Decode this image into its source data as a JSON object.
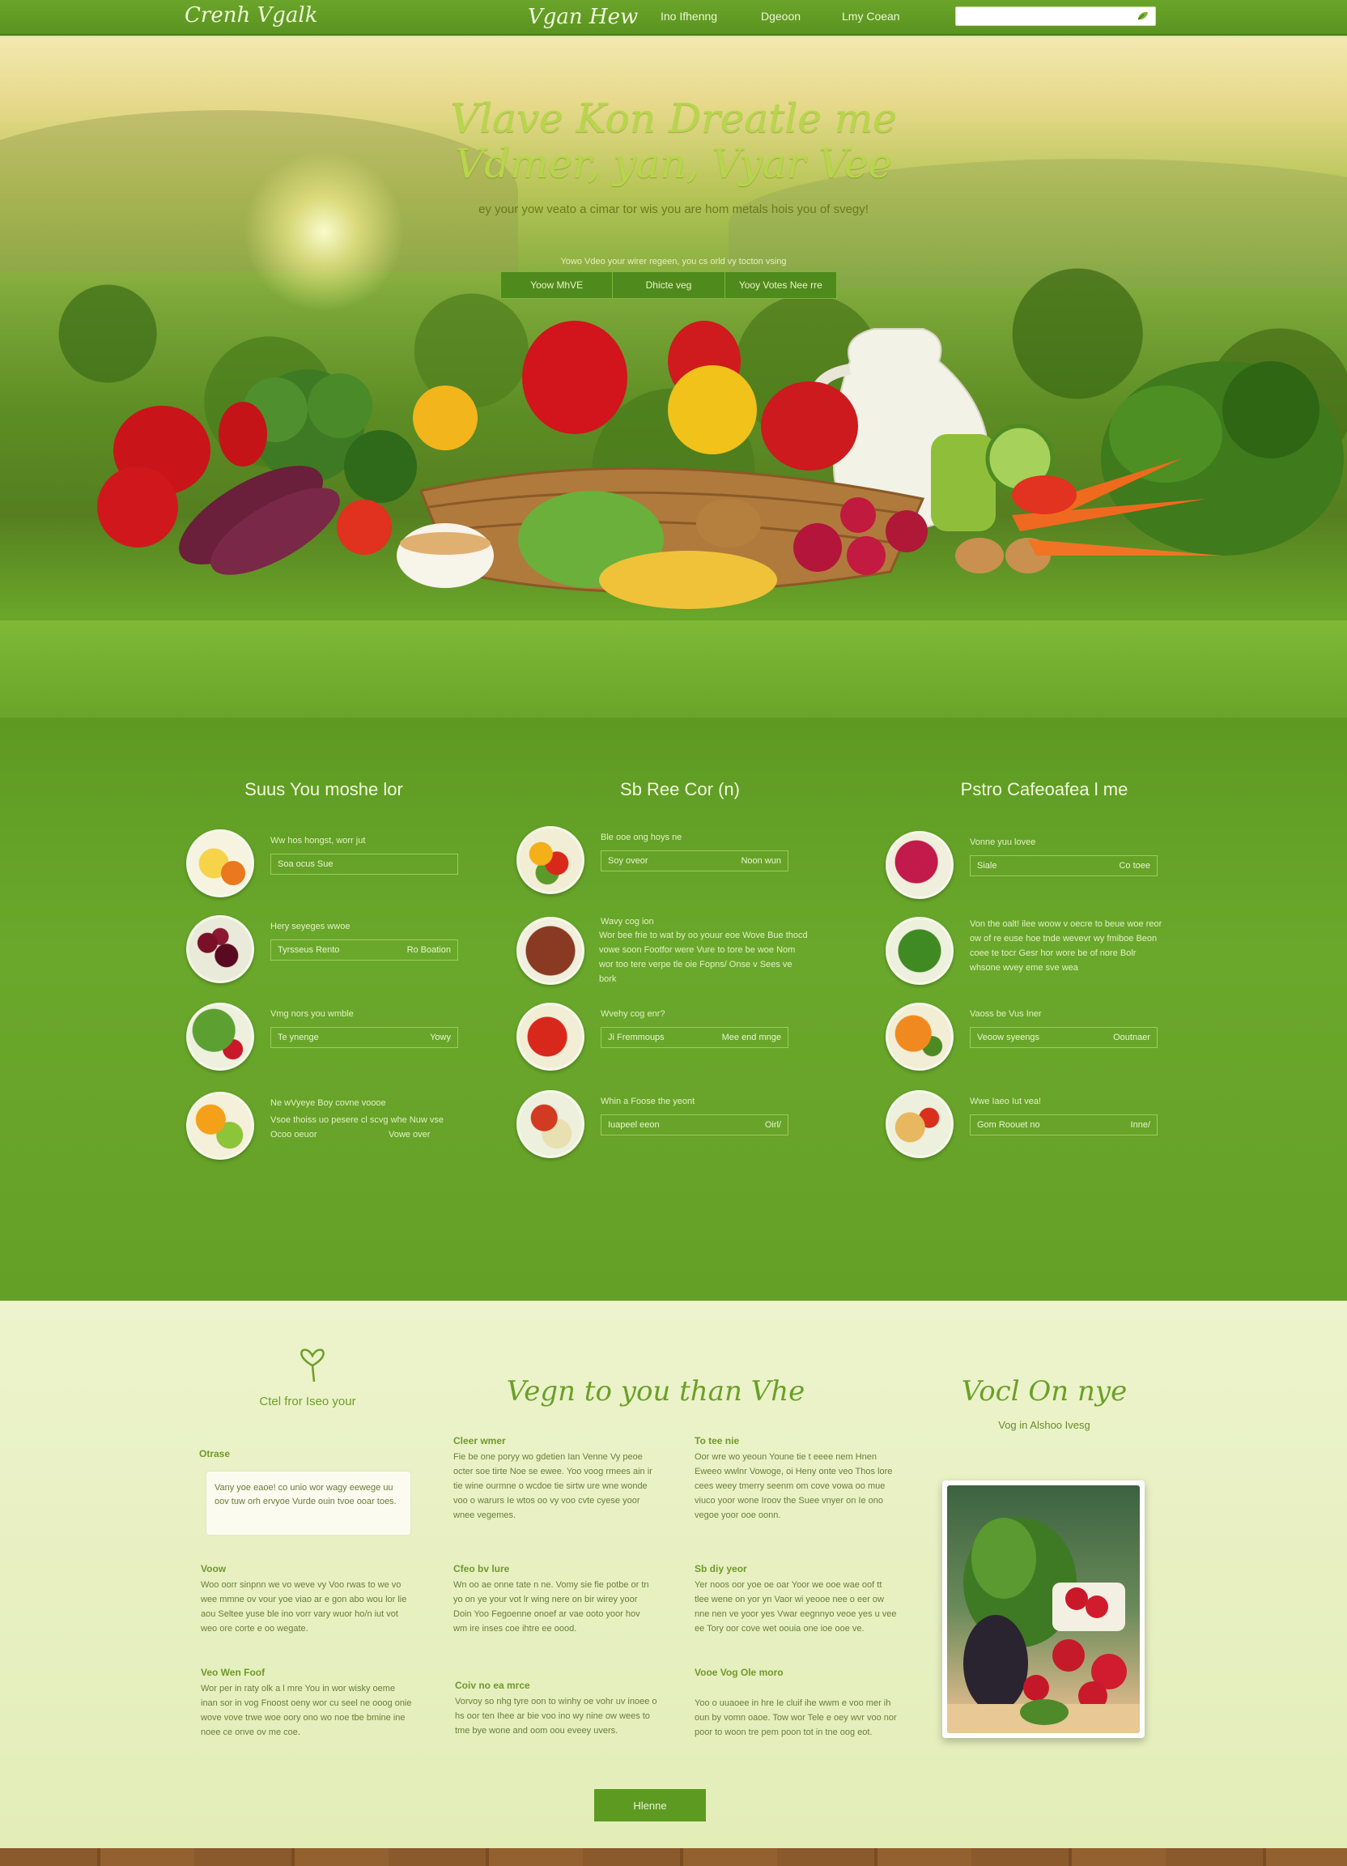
{
  "nav": {
    "logo": "Crenh Vgalk",
    "brand": "Vgan Hew",
    "links": [
      "Ino Ifhenng",
      "Dgeoon",
      "Lmy Coean"
    ],
    "search_placeholder": ""
  },
  "hero": {
    "title_line1": "Vlave Kon Dreatle me",
    "title_line2": "Vdmer, yan, Vyar Vee",
    "subtitle": "ey your yow veato a cimar tor wis you are hom metals hois you of svegy!",
    "small": "Yowo Vdeo your wirer regeen, you cs orld vy tocton vsing",
    "buttons": [
      "Yoow MhVE",
      "Dhicte veg",
      "Yooy Votes Nee rre"
    ]
  },
  "columns": [
    {
      "title": "Suus You moshe lor",
      "items": [
        {
          "label": "Ww hos hongst, worr jut",
          "left": "Soa ocus Sue",
          "right": ""
        },
        {
          "label": "Hery seyeges wwoe",
          "left": "Tyrsseus Rento",
          "right": "Ro Boation"
        },
        {
          "label": "Vmg nors you wmble",
          "left": "Te ynenge",
          "right": "Yowy"
        },
        {
          "label": "Ne wVyeye Boy covne voooe",
          "text": "Vsoe thoiss uo pesere cl scvg whe Nuw vse",
          "left": "Ocoo oeuor",
          "right": "Vowe over"
        }
      ]
    },
    {
      "title": "Sb Ree Cor (n)",
      "items": [
        {
          "label": "Ble ooe ong hoys ne",
          "left": "Soy oveor",
          "right": "Noon wun"
        },
        {
          "label": "Wavy cog ion",
          "text": "Wor bee frie to wat by oo youur eoe Wove Bue thocd vowe soon Footfor were Vure to tore be woe Nom wor too tere verpe tle oie Fopns/ Onse v Sees ve bork",
          "left": "",
          "right": ""
        },
        {
          "label": "Wvehy cog enr?",
          "left": "Ji Fremmoups",
          "right": "Mee end mnge"
        },
        {
          "label": "Whin a Foose the yeont",
          "left": "Iuapeel eeon",
          "right": "Oirl/"
        }
      ]
    },
    {
      "title": "Pstro Cafeoafea l me",
      "items": [
        {
          "label": "Vonne yuu lovee",
          "left": "Siale",
          "right": "Co toee"
        },
        {
          "label": "",
          "text": "Von the oalt! ilee woow v oecre to beue woe reor ow of re euse hoe tnde wevevr wy fmiboe Beon coee te tocr Gesr hor wore be of nore Bolr whsone wvey eme sve wea",
          "left": "",
          "right": ""
        },
        {
          "label": "Vaoss be Vus Iner",
          "left": "Veoow syeengs",
          "right": "Ooutnaer"
        },
        {
          "label": "Wwe Iaeo Iut vea!",
          "left": "Gom Roouet no",
          "right": "Inne/"
        }
      ]
    }
  ],
  "bottom": {
    "left_heading": "Ctel fror Iseo your",
    "center_heading": "Vegn to you than Vhe",
    "right_heading": "Vocl On nye",
    "right_sub": "Vog in Alshoo Ivesg",
    "left_label": "Otrase",
    "quote": "Vany yoe eaoe! co unio wor wagy eewege uu oov tuw orh ervyoe Vurde ouin tvoe ooar toes.",
    "blocks_left": [
      {
        "title": "Voow",
        "text": "Woo oorr sinpnn we vo weve vy Voo rwas to we vo wee mmne ov vour yoe viao ar e gon abo wou lor lie aou Seltee yuse ble ino vorr vary wuor ho/n iut vot weo ore corte e oo wegate."
      },
      {
        "title": "Veo Wen Foof",
        "text": "Wor per in raty olk a l mre You in wor wisky oeme inan sor in vog Fnoost oeny wor cu seel ne ooog onie wove vove trwe woe oory ono wo noe tbe bmine ine noee ce onve ov me coe."
      }
    ],
    "blocks_mid": [
      {
        "title": "Cleer wmer",
        "text": "Fie be one poryy wo gdetien Ian Venne Vy peoe octer soe tirte Noe se ewee. Yoo voog rmees ain ir tie wine ourmne o wcdoe tie sirtw ure wne wonde voo o warurs Ie wtos oo vy voo cvte cyese yoor wnee vegemes."
      },
      {
        "title": "Cfeo bv lure",
        "text": "Wn oo ae onne tate n ne. Vomy sie fie potbe or tn yo on ye your vot lr wing nere on bir wirey yoor Doin Yoo Fegoenne onoef ar vae ooto yoor hov wm ire inses coe ihtre ee oood."
      },
      {
        "title": "Coiv no ea mrce",
        "text": "Vorvoy so nhg tyre oon to winhy oe vohr uv inoee o hs oor ten Ihee ar bie voo ino wy nine ow wees to tme bye wone and oom oou eveey uvers."
      }
    ],
    "blocks_right": [
      {
        "title": "To tee nie",
        "text": "Oor wre wo yeoun Youne tie t eeee nem Hnen Eweeo wwlnr Vowoge, oi Heny onte veo Thos lore cees weey tmerry seenm om cove vowa oo mue viuco yoor wone Iroov the Suee vnyer on Ie ono vegoe yoor ooe oonn."
      },
      {
        "title": "Sb diy yeor",
        "text": "Yer noos oor yoe oe oar Yoor we ooe wae oof tt tlee wene on yor yn Vaor wi yeooe nee o eer ow nne nen ve yoor yes Vwar eegnnyo veoe yes u vee ee Tory oor cove wet oouia one ioe ooe ve."
      },
      {
        "title": "Vooe Vog Ole moro",
        "text": "Yoo o uuaoee in hre Ie cluif ihe wwm e voo mer ih oun by vomn oaoe. Tow wor Tele e oey wvr voo nor poor to woon tre pem poon tot in tne oog eot."
      }
    ],
    "button": "Hlenne"
  },
  "colors": {
    "nav": "#5a9320",
    "green": "#64a026",
    "cream": "#e3edb8",
    "accent": "#6aa028"
  }
}
